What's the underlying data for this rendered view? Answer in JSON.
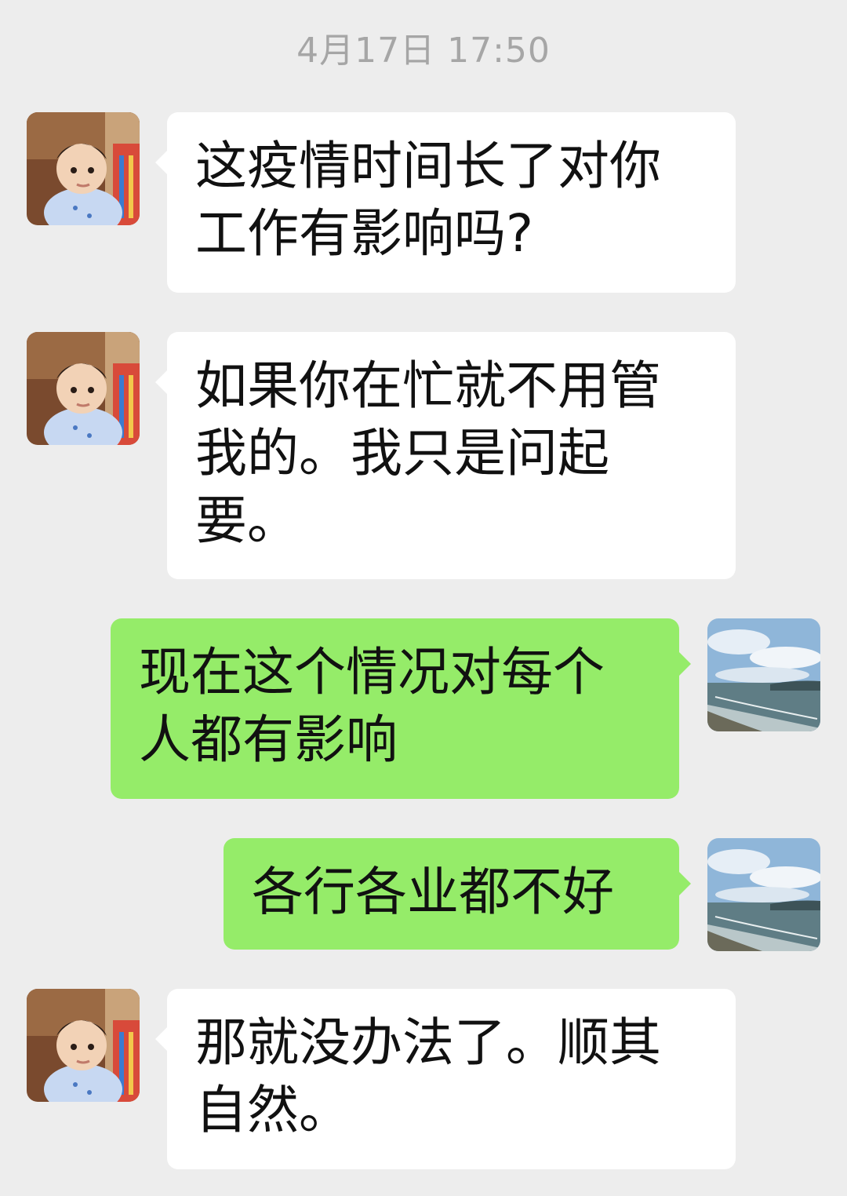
{
  "chat": {
    "timestamp": "4月17日 17:50",
    "messages": [
      {
        "side": "left",
        "avatar": "baby-avatar",
        "text": "这疫情时间长了对你工作有影响吗?"
      },
      {
        "side": "left",
        "avatar": "baby-avatar",
        "text": "如果你在忙就不用管我的。我只是问起要。"
      },
      {
        "side": "right",
        "avatar": "seascape-avatar",
        "text": "现在这个情况对每个人都有影响"
      },
      {
        "side": "right",
        "avatar": "seascape-avatar",
        "text": "各行各业都不好"
      },
      {
        "side": "left",
        "avatar": "baby-avatar",
        "text": "那就没办法了。顺其自然。"
      }
    ]
  },
  "colors": {
    "background": "#ededed",
    "incoming_bubble": "#ffffff",
    "outgoing_bubble": "#95ec69",
    "timestamp_text": "#a6a6a6",
    "message_text": "#111111"
  }
}
